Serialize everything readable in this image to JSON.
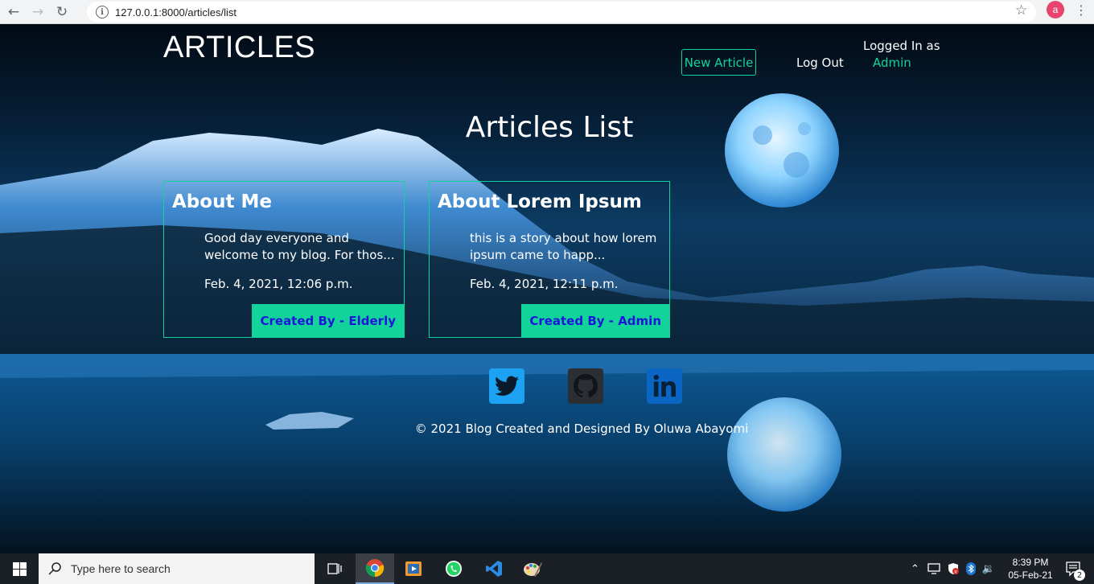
{
  "browser": {
    "url": "127.0.0.1:8000/articles/list",
    "profile_initial": "a"
  },
  "site": {
    "title": "ARTICLES",
    "nav": {
      "new_article": "New Article",
      "logout": "Log Out",
      "logged_in_label": "Logged In as",
      "logged_in_user": "Admin"
    },
    "heading": "Articles List",
    "articles": [
      {
        "title": "About Me",
        "snippet": "Good day everyone and welcome to my blog. For thos...",
        "date": "Feb. 4, 2021, 12:06 p.m.",
        "author": "Created By - Elderly"
      },
      {
        "title": "About Lorem Ipsum",
        "snippet": "this is a story about how lorem ipsum came to happ...",
        "date": "Feb. 4, 2021, 12:11 p.m.",
        "author": "Created By - Admin"
      }
    ],
    "social": [
      {
        "name": "twitter-icon",
        "color": "#1da1f2"
      },
      {
        "name": "github-icon",
        "color": "#333333"
      },
      {
        "name": "linkedin-icon",
        "color": "#0a66c2"
      }
    ],
    "footer": "© 2021 Blog Created and Designed By Oluwa Abayomi",
    "colors": {
      "accent": "#12d49b",
      "author_text": "#1b16d8"
    }
  },
  "taskbar": {
    "search_placeholder": "Type here to search",
    "time": "8:39 PM",
    "date": "05-Feb-21",
    "notifications": "2"
  }
}
